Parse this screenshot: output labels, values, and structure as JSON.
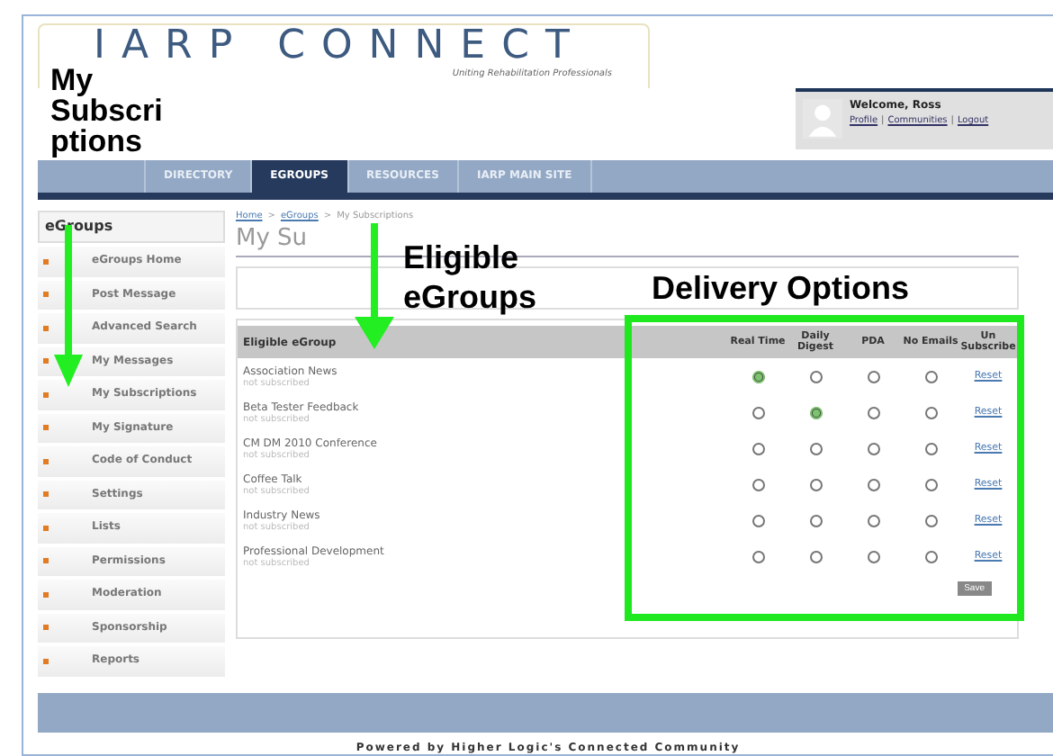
{
  "header": {
    "logo": "IARP CONNECT",
    "tagline": "Uniting Rehabilitation Professionals",
    "welcome": "Welcome, Ross",
    "links": [
      "Profile",
      "Communities",
      "Logout"
    ],
    "link_separator": "|"
  },
  "nav": [
    {
      "selected": false
    },
    {
      "label": "DIRECTORY",
      "selected": false
    },
    {
      "label": "EGROUPS",
      "selected": true
    },
    {
      "label": "RESOURCES",
      "selected": false
    },
    {
      "label": "IARP MAIN SITE",
      "selected": false
    }
  ],
  "sidebar": {
    "title": "eGroups",
    "items": [
      "eGroups Home",
      "Post Message",
      "Advanced Search",
      "My Messages",
      "My Subscriptions",
      "My Signature",
      "Code of Conduct",
      "Settings",
      "Lists",
      "Permissions",
      "Moderation",
      "Sponsorship",
      "Reports"
    ]
  },
  "breadcrumb": [
    "Home",
    "eGroups",
    "My Subscriptions"
  ],
  "breadcrumb_separator": ">",
  "page_title": "My Su",
  "table": {
    "columns": [
      "Eligible eGroup",
      "Real Time",
      "Daily Digest",
      "PDA",
      "No Emails",
      "Un Subscribe"
    ],
    "rows": [
      {
        "name": "Association News",
        "status": "not subscribed",
        "options": [
          {
            "selected": true
          },
          {
            "selected": false
          },
          {
            "selected": false
          },
          {
            "selected": false
          }
        ],
        "action": "Reset"
      },
      {
        "name": "Beta Tester Feedback",
        "status": "not subscribed",
        "options": [
          {
            "selected": false
          },
          {
            "selected": true
          },
          {
            "selected": false
          },
          {
            "selected": false
          }
        ],
        "action": "Reset"
      },
      {
        "name": "CM DM 2010 Conference",
        "status": "not subscribed",
        "options": [
          {
            "selected": false
          },
          {
            "selected": false
          },
          {
            "selected": false
          },
          {
            "selected": false
          }
        ],
        "action": "Reset"
      },
      {
        "name": "Coffee Talk",
        "status": "not subscribed",
        "options": [
          {
            "selected": false
          },
          {
            "selected": false
          },
          {
            "selected": false
          },
          {
            "selected": false
          }
        ],
        "action": "Reset"
      },
      {
        "name": "Industry News",
        "status": "not subscribed",
        "options": [
          {
            "selected": false
          },
          {
            "selected": false
          },
          {
            "selected": false
          },
          {
            "selected": false
          }
        ],
        "action": "Reset"
      },
      {
        "name": "Professional Development",
        "status": "not subscribed",
        "options": [
          {
            "selected": false
          },
          {
            "selected": false
          },
          {
            "selected": false
          },
          {
            "selected": false
          }
        ],
        "action": "Reset"
      }
    ],
    "save": "Save"
  },
  "footer": "Powered by Higher Logic's Connected Community",
  "annotations": [
    "My Subscri ptions",
    "Eligible eGroups",
    "Delivery Options"
  ]
}
